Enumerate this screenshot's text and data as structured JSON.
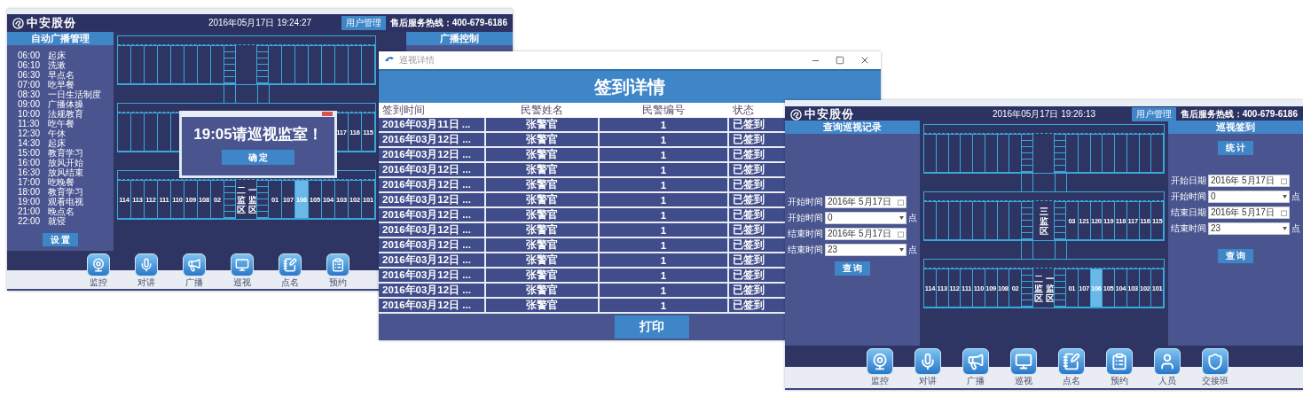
{
  "broadcast_window": {
    "brand": "中安股份",
    "datetime": "2016年05月17日 19:24:27",
    "user_button": "用户管理",
    "hotline": "售后服务热线：400-679-6186",
    "left_panel": {
      "title": "自动广播管理",
      "schedule": [
        {
          "time": "06:00",
          "event": "起床"
        },
        {
          "time": "06:10",
          "event": "洗漱"
        },
        {
          "time": "06:30",
          "event": "早点名"
        },
        {
          "time": "07:00",
          "event": "吃早餐"
        },
        {
          "time": "08:30",
          "event": "一日生活制度"
        },
        {
          "time": "09:00",
          "event": "广播体操"
        },
        {
          "time": "10:00",
          "event": "法规教育"
        },
        {
          "time": "11:30",
          "event": "吃午餐"
        },
        {
          "time": "12:30",
          "event": "午休"
        },
        {
          "time": "14:30",
          "event": "起床"
        },
        {
          "time": "15:00",
          "event": "教育学习"
        },
        {
          "time": "16:00",
          "event": "放风开始"
        },
        {
          "time": "16:30",
          "event": "放风结束"
        },
        {
          "time": "17:00",
          "event": "吃晚餐"
        },
        {
          "time": "18:00",
          "event": "教育学习"
        },
        {
          "time": "19:00",
          "event": "观看电视"
        },
        {
          "time": "21:00",
          "event": "晚点名"
        },
        {
          "time": "22:00",
          "event": "就寝"
        }
      ],
      "button": "设 置"
    },
    "right_panel": {
      "title": "广播控制"
    },
    "floor_plan": {
      "wings": [
        {
          "kind": "top"
        },
        {
          "kind": "middle",
          "rooms_right": [
            {
              "label": "117",
              "selected": false
            },
            {
              "label": "116",
              "selected": false
            },
            {
              "label": "115",
              "selected": false
            }
          ]
        },
        {
          "kind": "bottom",
          "rooms_left": [
            {
              "label": "114",
              "selected": false
            },
            {
              "label": "113",
              "selected": false
            },
            {
              "label": "112",
              "selected": false
            },
            {
              "label": "111",
              "selected": false
            },
            {
              "label": "110",
              "selected": false
            },
            {
              "label": "109",
              "selected": false
            },
            {
              "label": "108",
              "selected": false
            },
            {
              "label": "02",
              "selected": false
            }
          ],
          "area_labels": [
            "二监区",
            "一监区"
          ],
          "rooms_right": [
            {
              "label": "01",
              "selected": false
            },
            {
              "label": "107",
              "selected": false
            },
            {
              "label": "106",
              "selected": true
            },
            {
              "label": "105",
              "selected": false
            },
            {
              "label": "104",
              "selected": false
            },
            {
              "label": "103",
              "selected": false
            },
            {
              "label": "102",
              "selected": false
            },
            {
              "label": "101",
              "selected": false
            }
          ]
        }
      ]
    },
    "dock": [
      {
        "label": "监控",
        "kind": "camera"
      },
      {
        "label": "对讲",
        "kind": "mic"
      },
      {
        "label": "广播",
        "kind": "megaphone"
      },
      {
        "label": "巡视",
        "kind": "monitor"
      },
      {
        "label": "点名",
        "kind": "notepad"
      },
      {
        "label": "预约",
        "kind": "list"
      }
    ],
    "alert_dialog": {
      "message": "19:05请巡视监室！",
      "button": "确 定"
    }
  },
  "sign_in_window": {
    "title": "巡视详情",
    "heading": "签到详情",
    "columns": [
      "签到时间",
      "民警姓名",
      "民警编号",
      "状态"
    ],
    "rows": [
      [
        "2016年03月11日 ...",
        "张警官",
        "1",
        "已签到"
      ],
      [
        "2016年03月12日 ...",
        "张警官",
        "1",
        "已签到"
      ],
      [
        "2016年03月12日 ...",
        "张警官",
        "1",
        "已签到"
      ],
      [
        "2016年03月12日 ...",
        "张警官",
        "1",
        "已签到"
      ],
      [
        "2016年03月12日 ...",
        "张警官",
        "1",
        "已签到"
      ],
      [
        "2016年03月12日 ...",
        "张警官",
        "1",
        "已签到"
      ],
      [
        "2016年03月12日 ...",
        "张警官",
        "1",
        "已签到"
      ],
      [
        "2016年03月12日 ...",
        "张警官",
        "1",
        "已签到"
      ],
      [
        "2016年03月12日 ...",
        "张警官",
        "1",
        "已签到"
      ],
      [
        "2016年03月12日 ...",
        "张警官",
        "1",
        "已签到"
      ],
      [
        "2016年03月12日 ...",
        "张警官",
        "1",
        "已签到"
      ],
      [
        "2016年03月12日 ...",
        "张警官",
        "1",
        "已签到"
      ],
      [
        "2016年03月12日 ...",
        "张警官",
        "1",
        "已签到"
      ]
    ],
    "print_button": "打印"
  },
  "patrol_window": {
    "brand": "中安股份",
    "datetime": "2016年05月17日 19:26:13",
    "user_button": "用户管理",
    "hotline": "售后服务热线：400-679-6186",
    "left_panel": {
      "title": "查询巡视记录",
      "fields": [
        {
          "label": "开始时间",
          "kind": "date",
          "value": "2016年 5月17日"
        },
        {
          "label": "开始时间",
          "kind": "hour",
          "value": "0",
          "unit": "点"
        },
        {
          "label": "结束时间",
          "kind": "date",
          "value": "2016年 5月17日"
        },
        {
          "label": "结束时间",
          "kind": "hour",
          "value": "23",
          "unit": "点"
        }
      ],
      "button": "查 询"
    },
    "right_panel": {
      "title": "巡视签到",
      "top_button": "统 计",
      "fields": [
        {
          "label": "开始日期",
          "kind": "date",
          "value": "2016年 5月17日"
        },
        {
          "label": "开始时间",
          "kind": "hour",
          "value": "0",
          "unit": "点"
        },
        {
          "label": "结束日期",
          "kind": "date",
          "value": "2016年 5月17日"
        },
        {
          "label": "结束时间",
          "kind": "hour",
          "value": "23",
          "unit": "点"
        }
      ],
      "button": "查 询"
    },
    "floor_plan": {
      "wings": [
        {
          "kind": "top"
        },
        {
          "kind": "middle",
          "area_labels": [
            "三监区"
          ],
          "rooms_right": [
            {
              "label": "03",
              "selected": false
            },
            {
              "label": "121",
              "selected": false
            },
            {
              "label": "120",
              "selected": false
            },
            {
              "label": "119",
              "selected": false
            },
            {
              "label": "118",
              "selected": false
            },
            {
              "label": "117",
              "selected": false
            },
            {
              "label": "116",
              "selected": false
            },
            {
              "label": "115",
              "selected": false
            }
          ]
        },
        {
          "kind": "bottom",
          "rooms_left": [
            {
              "label": "114",
              "selected": false
            },
            {
              "label": "113",
              "selected": false
            },
            {
              "label": "112",
              "selected": false
            },
            {
              "label": "111",
              "selected": false
            },
            {
              "label": "110",
              "selected": false
            },
            {
              "label": "109",
              "selected": false
            },
            {
              "label": "108",
              "selected": false
            },
            {
              "label": "02",
              "selected": false
            }
          ],
          "area_labels": [
            "二监区",
            "一监区"
          ],
          "rooms_right": [
            {
              "label": "01",
              "selected": false
            },
            {
              "label": "107",
              "selected": false
            },
            {
              "label": "106",
              "selected": true
            },
            {
              "label": "105",
              "selected": false
            },
            {
              "label": "104",
              "selected": false
            },
            {
              "label": "103",
              "selected": false
            },
            {
              "label": "102",
              "selected": false
            },
            {
              "label": "101",
              "selected": false
            }
          ]
        }
      ]
    },
    "dock": [
      {
        "label": "监控",
        "kind": "camera"
      },
      {
        "label": "对讲",
        "kind": "mic"
      },
      {
        "label": "广播",
        "kind": "megaphone"
      },
      {
        "label": "巡视",
        "kind": "monitor"
      },
      {
        "label": "点名",
        "kind": "notepad"
      },
      {
        "label": "预约",
        "kind": "list"
      },
      {
        "label": "人员",
        "kind": "person"
      },
      {
        "label": "交接班",
        "kind": "officer"
      }
    ]
  }
}
